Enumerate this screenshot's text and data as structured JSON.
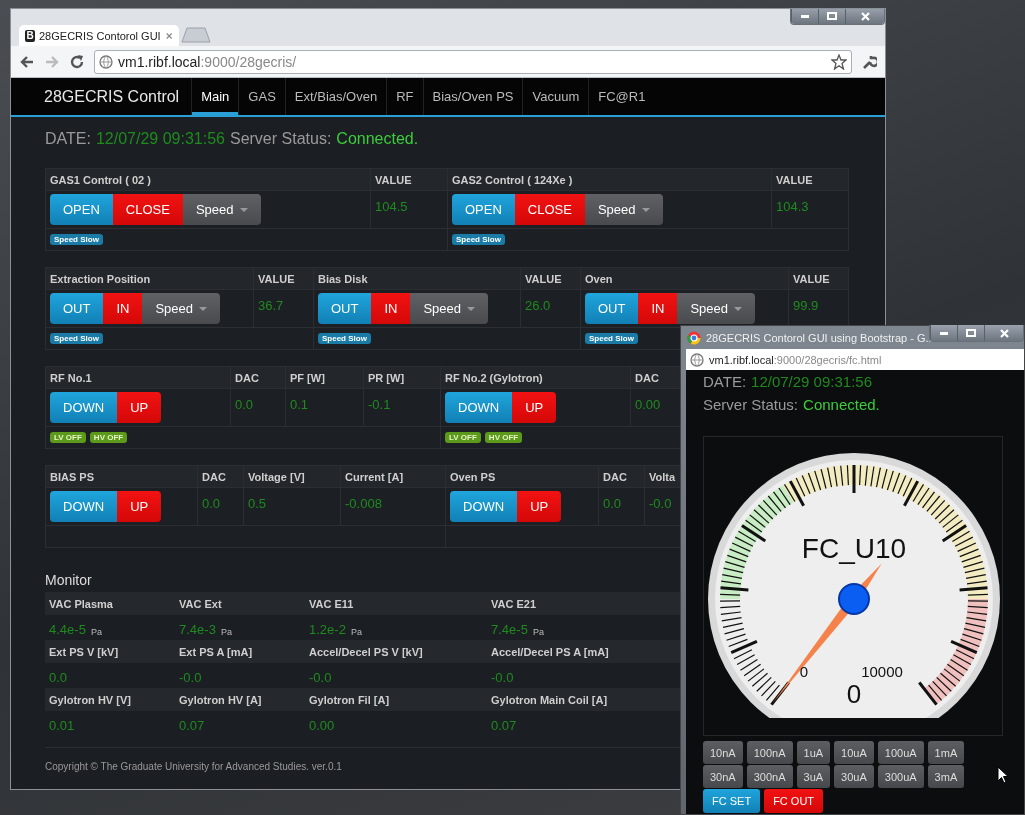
{
  "main_window": {
    "tab": {
      "favicon": "B",
      "title": "28GECRIS Contorol GUI"
    },
    "address": {
      "host": "vm1.ribf.local",
      "path": ":9000/28gecris/"
    },
    "nav": {
      "brand": "28GECRIS Control",
      "items": [
        {
          "label": "Main",
          "selected": true
        },
        {
          "label": "GAS",
          "selected": false
        },
        {
          "label": "Ext/Bias/Oven",
          "selected": false
        },
        {
          "label": "RF",
          "selected": false
        },
        {
          "label": "Bias/Oven PS",
          "selected": false
        },
        {
          "label": "Vacuum",
          "selected": false
        },
        {
          "label": "FC@R1",
          "selected": false
        }
      ]
    },
    "status": {
      "date_label": "DATE:",
      "date": "12/07/29 09:31:56",
      "server_label": "Server Status:",
      "server_status": "Connected."
    },
    "control_tables": [
      {
        "groups": [
          {
            "title": "GAS1 Control ( 02 )",
            "buttons": [
              {
                "label": "OPEN",
                "kind": "primary"
              },
              {
                "label": "CLOSE",
                "kind": "danger"
              },
              {
                "label": "Speed",
                "kind": "dropdown"
              }
            ],
            "badges": [
              {
                "label": "Speed Slow",
                "kind": "info"
              }
            ],
            "columns": [
              {
                "label": "VALUE",
                "value": "104.5"
              }
            ]
          },
          {
            "title": "GAS2 Control ( 124Xe )",
            "buttons": [
              {
                "label": "OPEN",
                "kind": "primary"
              },
              {
                "label": "CLOSE",
                "kind": "danger"
              },
              {
                "label": "Speed",
                "kind": "dropdown"
              }
            ],
            "badges": [
              {
                "label": "Speed Slow",
                "kind": "info"
              }
            ],
            "columns": [
              {
                "label": "VALUE",
                "value": "104.3"
              }
            ]
          }
        ]
      },
      {
        "groups": [
          {
            "title": "Extraction Position",
            "buttons": [
              {
                "label": "OUT",
                "kind": "primary"
              },
              {
                "label": "IN",
                "kind": "danger"
              },
              {
                "label": "Speed",
                "kind": "dropdown"
              }
            ],
            "badges": [
              {
                "label": "Speed Slow",
                "kind": "info"
              }
            ],
            "columns": [
              {
                "label": "VALUE",
                "value": "36.7"
              }
            ]
          },
          {
            "title": "Bias Disk",
            "buttons": [
              {
                "label": "OUT",
                "kind": "primary"
              },
              {
                "label": "IN",
                "kind": "danger"
              },
              {
                "label": "Speed",
                "kind": "dropdown"
              }
            ],
            "badges": [
              {
                "label": "Speed Slow",
                "kind": "info"
              }
            ],
            "columns": [
              {
                "label": "VALUE",
                "value": "26.0"
              }
            ]
          },
          {
            "title": "Oven",
            "buttons": [
              {
                "label": "OUT",
                "kind": "primary"
              },
              {
                "label": "IN",
                "kind": "danger"
              },
              {
                "label": "Speed",
                "kind": "dropdown"
              }
            ],
            "badges": [
              {
                "label": "Speed Slow",
                "kind": "info"
              }
            ],
            "columns": [
              {
                "label": "VALUE",
                "value": "99.9"
              }
            ]
          }
        ]
      },
      {
        "groups": [
          {
            "title": "RF No.1",
            "buttons": [
              {
                "label": "DOWN",
                "kind": "primary"
              },
              {
                "label": "UP",
                "kind": "danger"
              }
            ],
            "badges": [
              {
                "label": "LV OFF",
                "kind": "success"
              },
              {
                "label": "HV OFF",
                "kind": "success"
              }
            ],
            "columns": [
              {
                "label": "DAC",
                "value": "0.0"
              },
              {
                "label": "PF [W]",
                "value": "0.1"
              },
              {
                "label": "PR [W]",
                "value": "-0.1"
              }
            ]
          },
          {
            "title": "RF No.2 (Gylotron)",
            "buttons": [
              {
                "label": "DOWN",
                "kind": "primary"
              },
              {
                "label": "UP",
                "kind": "danger"
              }
            ],
            "badges": [
              {
                "label": "LV OFF",
                "kind": "success"
              },
              {
                "label": "HV OFF",
                "kind": "success"
              }
            ],
            "columns": [
              {
                "label": "DAC",
                "value": "0.00"
              }
            ]
          }
        ]
      },
      {
        "groups": [
          {
            "title": "BIAS PS",
            "buttons": [
              {
                "label": "DOWN",
                "kind": "primary"
              },
              {
                "label": "UP",
                "kind": "danger"
              }
            ],
            "columns": [
              {
                "label": "DAC",
                "value": "0.0"
              },
              {
                "label": "Voltage [V]",
                "value": "0.5"
              },
              {
                "label": "Current [A]",
                "value": "-0.008"
              }
            ]
          },
          {
            "title": "Oven PS",
            "buttons": [
              {
                "label": "DOWN",
                "kind": "primary"
              },
              {
                "label": "UP",
                "kind": "danger"
              }
            ],
            "columns": [
              {
                "label": "DAC",
                "value": "0.0"
              },
              {
                "label": "Volta",
                "value": "-0.0"
              }
            ]
          }
        ]
      }
    ],
    "monitor": {
      "title": "Monitor",
      "rows": [
        [
          {
            "label": "VAC Plasma",
            "value": "4.4e-5",
            "unit": "Pa"
          },
          {
            "label": "VAC Ext",
            "value": "7.4e-3",
            "unit": "Pa"
          },
          {
            "label": "VAC E11",
            "value": "1.2e-2",
            "unit": "Pa"
          },
          {
            "label": "VAC E21",
            "value": "7.4e-5",
            "unit": "Pa"
          }
        ],
        [
          {
            "label": "Ext PS V [kV]",
            "value": "0.0"
          },
          {
            "label": "Ext PS A [mA]",
            "value": "-0.0"
          },
          {
            "label": "Accel/Decel PS V [kV]",
            "value": "-0.0"
          },
          {
            "label": "Accel/Decel PS A [mA]",
            "value": "-0.0"
          }
        ],
        [
          {
            "label": "Gylotron HV [V]",
            "value": "0.01"
          },
          {
            "label": "Gylotron HV [A]",
            "value": "0.07"
          },
          {
            "label": "Gylotron Fil [A]",
            "value": "0.00"
          },
          {
            "label": "Gylotron Main Coil [A]",
            "value": "0.07"
          }
        ]
      ]
    },
    "footer": "Copyright © The Graduate University for Advanced Studies. ver.0.1"
  },
  "popup_window": {
    "title": "28GECRIS Contorol GUI using Bootstrap - G...",
    "address": {
      "host": "vm1.ribf.local",
      "path": ":9000/28gecris/fc.html"
    },
    "status": {
      "date_label": "DATE:",
      "date": "12/07/29 09:31:56",
      "server_label": "Server Status:",
      "server_status": "Connected."
    },
    "gauge": {
      "title": "FC_U10",
      "min_label": "0",
      "max_label": "10000",
      "reading": "0"
    },
    "ranges": [
      [
        "10nA",
        "100nA",
        "1uA",
        "10uA",
        "100uA",
        "1mA"
      ],
      [
        "30nA",
        "300nA",
        "3uA",
        "30uA",
        "300uA",
        "3mA"
      ]
    ],
    "buttons": [
      {
        "label": "FC SET",
        "kind": "primary"
      },
      {
        "label": "FC OUT",
        "kind": "danger"
      }
    ]
  }
}
